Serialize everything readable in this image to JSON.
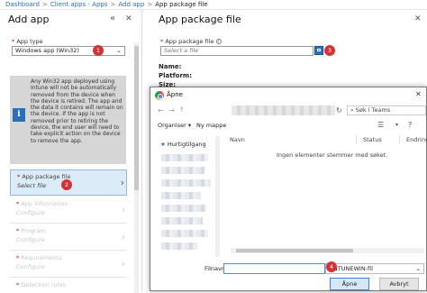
{
  "breadcrumb": {
    "items": [
      "Dashboard",
      "Client apps - Apps",
      "Add app",
      "App package file"
    ],
    "separator": ">"
  },
  "left_blade": {
    "title": "Add app",
    "controls": {
      "collapse": "«",
      "close": "✕"
    },
    "app_type": {
      "label": "App type",
      "required": "*",
      "value": "Windows app (Win32)",
      "badge": "1"
    },
    "info": {
      "text": "Any Win32 app deployed using Intune will not be automatically removed from the device when the device is retired. The app and the data it contains will remain on the device. If the app is not removed prior to retiring the device, the end user will need to take explicit action on the device to remove the app."
    },
    "steps": [
      {
        "title": "App package file",
        "subtitle": "Select file",
        "required": "*",
        "badge": "2"
      },
      {
        "title": "App information",
        "subtitle": "Configure",
        "required": "*"
      },
      {
        "title": "Program",
        "subtitle": "Configure",
        "required": "*"
      },
      {
        "title": "Requirements",
        "subtitle": "Configure",
        "required": "*"
      },
      {
        "title": "Detection rules",
        "subtitle": "",
        "required": "*"
      }
    ]
  },
  "right_blade": {
    "title": "App package file",
    "controls": {
      "close": "✕"
    },
    "field_label": "App package file",
    "required": "*",
    "info_icon": "i",
    "placeholder": "Select a file",
    "badge": "3",
    "fields": [
      "Name:",
      "Platform:",
      "Size:"
    ]
  },
  "dialog": {
    "title": "Åpne",
    "close": "✕",
    "search_placeholder": "Søk i Teams",
    "toolbar": {
      "organize": "Organiser",
      "new_folder": "Ny mappe"
    },
    "nav": {
      "quick_access": "Hurtigtilgang"
    },
    "columns": [
      "Navn",
      "Status",
      "Endring"
    ],
    "empty_message": "Ingen elementer stemmer med søket.",
    "filename_label": "Filnavn:",
    "filter": "INTUNEWIN-fil",
    "badge": "4",
    "open_button": "Åpne",
    "cancel_button": "Avbryt"
  },
  "colors": {
    "link": "#2a6fd6",
    "badge": "#d13438",
    "info": "#2c6fb7",
    "active_step": "#dcebf8"
  }
}
